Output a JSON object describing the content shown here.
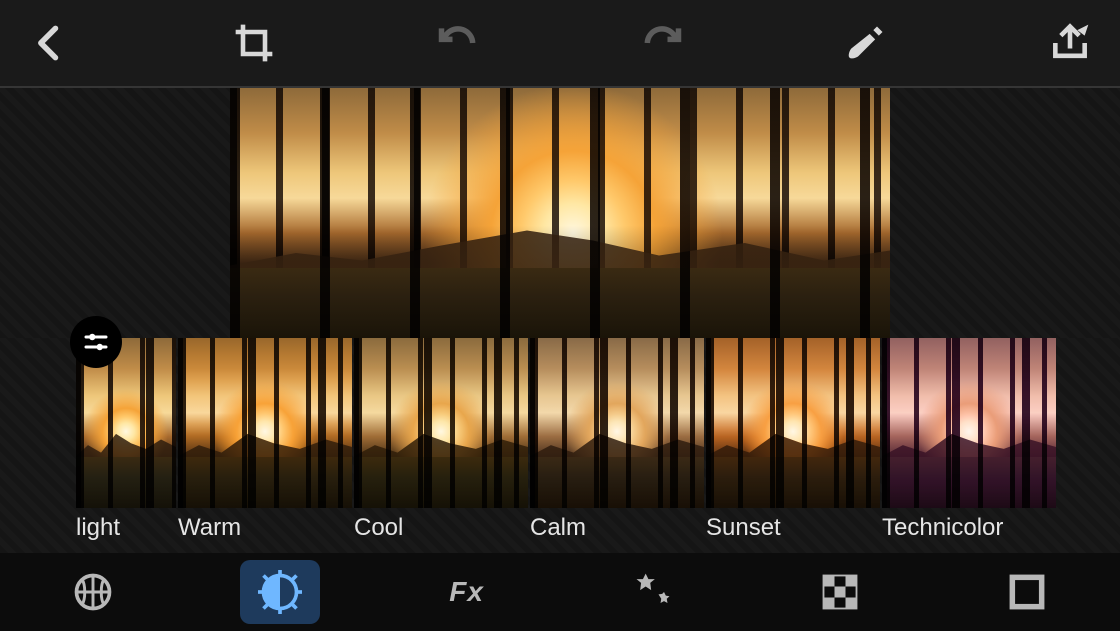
{
  "toolbar": {
    "back": "back",
    "crop": "crop",
    "undo": "undo",
    "redo": "redo",
    "brush": "brush",
    "share": "share"
  },
  "filters": [
    {
      "label": "light",
      "tint": "rgba(0,0,0,0)"
    },
    {
      "label": "Warm",
      "tint": "rgba(255,150,40,0.25)"
    },
    {
      "label": "Cool",
      "tint": "rgba(120,100,60,0.25)"
    },
    {
      "label": "Calm",
      "tint": "rgba(80,60,50,0.35)"
    },
    {
      "label": "Sunset",
      "tint": "rgba(255,120,40,0.30)"
    },
    {
      "label": "Technicolor",
      "tint": "rgba(200,130,200,0.40)"
    }
  ],
  "selected_filter_index": 0,
  "bottom_tabs": {
    "globe": "globe",
    "lighting": "lighting",
    "fx_label": "Fx",
    "stars": "stars",
    "checker": "checker",
    "frame": "frame",
    "active": "lighting"
  }
}
